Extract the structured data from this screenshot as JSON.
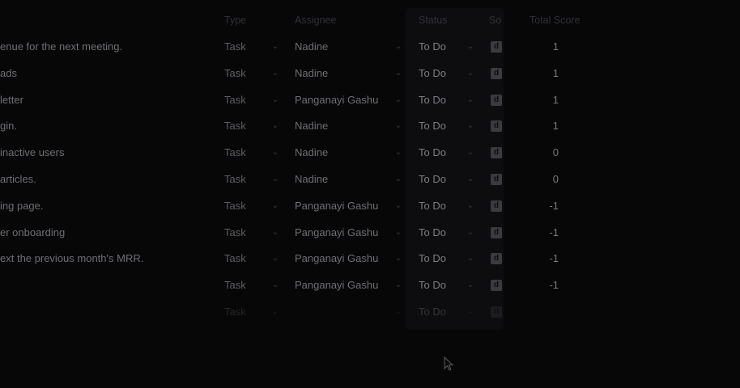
{
  "columns": {
    "type": "Type",
    "assignee": "Assignee",
    "status": "Status",
    "score": "So",
    "total": "Total Score"
  },
  "rows": [
    {
      "name": "enue for the next meeting.",
      "type": "Task",
      "assignee": "Nadine",
      "status": "To Do",
      "score_icon": "d",
      "total": "1"
    },
    {
      "name": "ads",
      "type": "Task",
      "assignee": "Nadine",
      "status": "To Do",
      "score_icon": "d",
      "total": "1"
    },
    {
      "name": "letter",
      "type": "Task",
      "assignee": "Panganayi Gashu",
      "status": "To Do",
      "score_icon": "d",
      "total": "1"
    },
    {
      "name": "gin.",
      "type": "Task",
      "assignee": "Nadine",
      "status": "To Do",
      "score_icon": "d",
      "total": "1"
    },
    {
      "name": "inactive users",
      "type": "Task",
      "assignee": "Nadine",
      "status": "To Do",
      "score_icon": "d",
      "total": "0"
    },
    {
      "name": "articles.",
      "type": "Task",
      "assignee": "Nadine",
      "status": "To Do",
      "score_icon": "d",
      "total": "0"
    },
    {
      "name": "ing page.",
      "type": "Task",
      "assignee": "Panganayi Gashu",
      "status": "To Do",
      "score_icon": "d",
      "total": "-1"
    },
    {
      "name": "er onboarding",
      "type": "Task",
      "assignee": "Panganayi Gashu",
      "status": "To Do",
      "score_icon": "d",
      "total": "-1"
    },
    {
      "name": "ext the previous month's MRR.",
      "type": "Task",
      "assignee": "Panganayi Gashu",
      "status": "To Do",
      "score_icon": "d",
      "total": "-1"
    },
    {
      "name": "",
      "type": "Task",
      "assignee": "Panganayi Gashu",
      "status": "To Do",
      "score_icon": "d",
      "total": "-1"
    },
    {
      "name": "",
      "type": "Task",
      "assignee": "",
      "status": "To Do",
      "score_icon": "d",
      "total": ""
    }
  ],
  "icons": {
    "chevron": "chevron-down-icon",
    "cursor": "mouse-pointer-icon"
  }
}
